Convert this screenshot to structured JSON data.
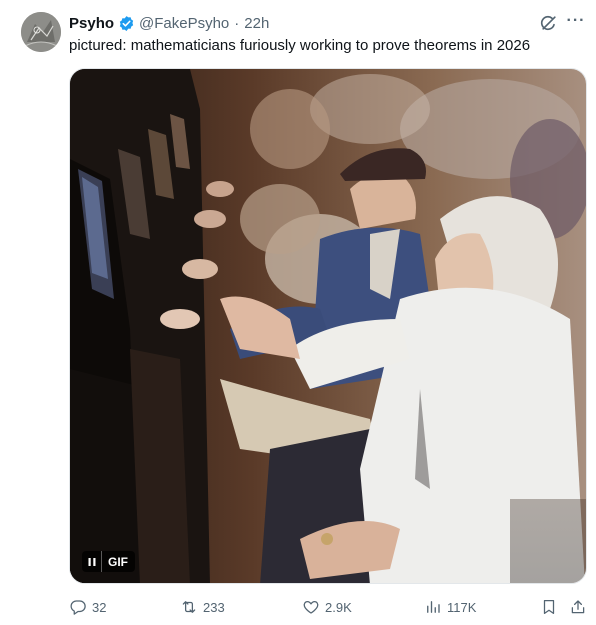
{
  "author": {
    "display_name": "Psyho",
    "handle": "@FakePsyho",
    "separator": "·",
    "time": "22h",
    "verified": true,
    "avatar_icon": "sketch-avatar-icon"
  },
  "tweet": {
    "text": "pictured: mathematicians furiously working to prove theorems in 2026"
  },
  "media": {
    "type": "gif",
    "badge_label": "GIF",
    "description_icon": "slot-machine-players-scene"
  },
  "actions": {
    "reply_count": "32",
    "retweet_count": "233",
    "like_count": "2.9K",
    "view_count": "117K"
  },
  "colors": {
    "verified_blue": "#1d9bf0",
    "secondary_text": "#536471",
    "primary_text": "#0f1419"
  }
}
